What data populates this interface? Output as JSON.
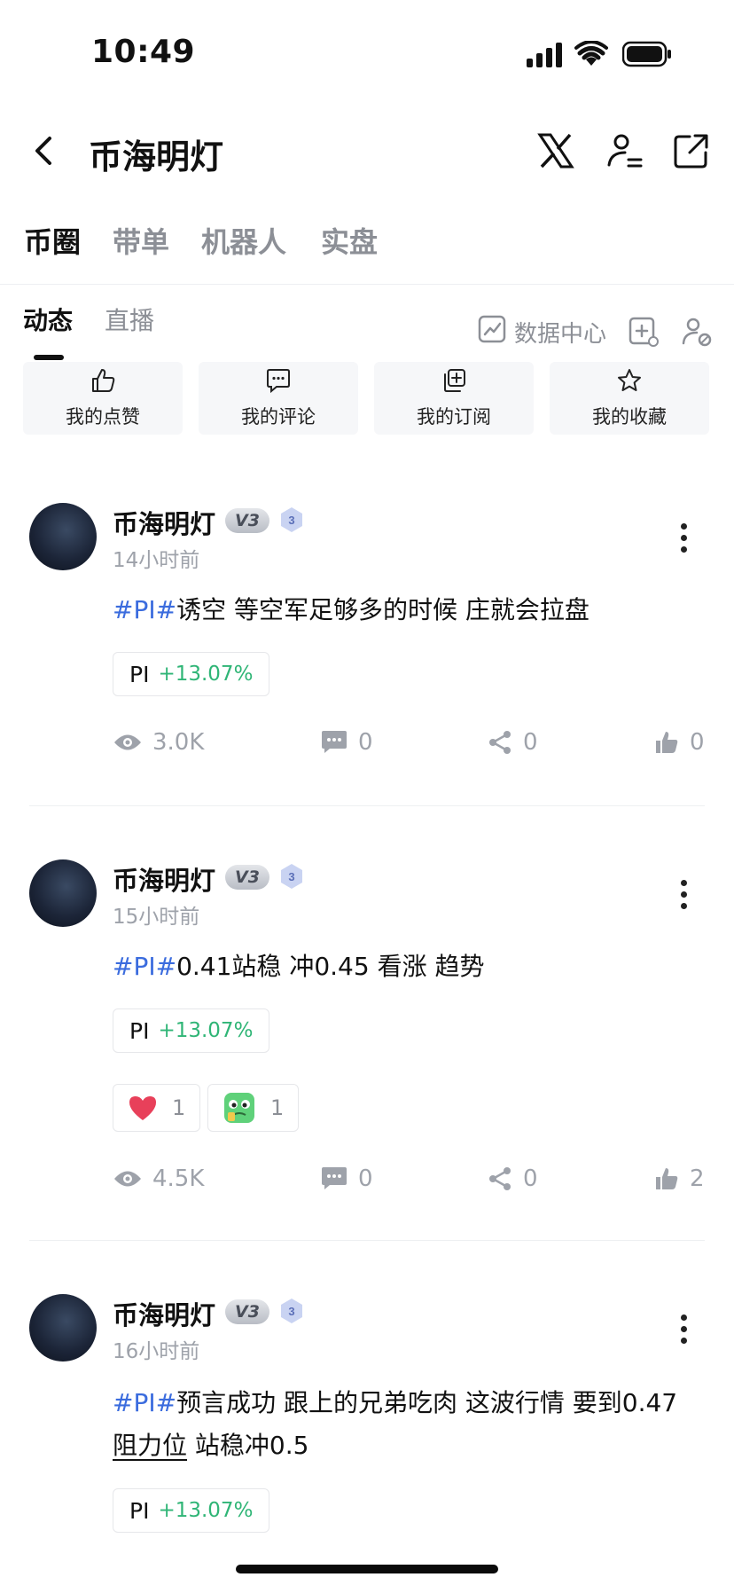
{
  "status_bar": {
    "time": "10:49"
  },
  "header": {
    "title": "币海明灯",
    "icons": [
      "back-arrow-icon",
      "x-logo-icon",
      "user-icon",
      "share-out-icon"
    ]
  },
  "tabs": [
    "币圈",
    "带单",
    "机器人",
    "实盘"
  ],
  "subtabs": [
    "动态",
    "直播"
  ],
  "tools": {
    "data_center": "数据中心"
  },
  "quick": [
    {
      "icon": "thumbs-up-icon",
      "label": "我的点赞"
    },
    {
      "icon": "comment-icon",
      "label": "我的评论"
    },
    {
      "icon": "subscribe-icon",
      "label": "我的订阅"
    },
    {
      "icon": "star-icon",
      "label": "我的收藏"
    }
  ],
  "posts": [
    {
      "name": "币海明灯",
      "vip": "V3",
      "level": "3",
      "time": "14小时前",
      "tag": "#PI#",
      "text": "诱空 等空军足够多的时候 庄就会拉盘",
      "coin": "PI",
      "pct": "+13.07%",
      "views": "3.0K",
      "comments": "0",
      "shares": "0",
      "likes": "0"
    },
    {
      "name": "币海明灯",
      "vip": "V3",
      "level": "3",
      "time": "15小时前",
      "tag": "#PI#",
      "text": "0.41站稳 冲0.45 看涨 趋势",
      "coin": "PI",
      "pct": "+13.07%",
      "reactions": [
        {
          "icon": "heart-icon",
          "count": "1"
        },
        {
          "icon": "money-face-emoji-icon",
          "count": "1"
        }
      ],
      "views": "4.5K",
      "comments": "0",
      "shares": "0",
      "likes": "2"
    },
    {
      "name": "币海明灯",
      "vip": "V3",
      "level": "3",
      "time": "16小时前",
      "tag": "#PI#",
      "text": "预言成功 跟上的兄弟吃肉 这波行情 要到0.47",
      "text2_link": "阻力位",
      "text2_rest": " 站稳冲0.5",
      "coin": "PI",
      "pct": "+13.07%"
    }
  ],
  "colors": {
    "accent_blue": "#3b6cde",
    "gain_green": "#2fb576"
  }
}
